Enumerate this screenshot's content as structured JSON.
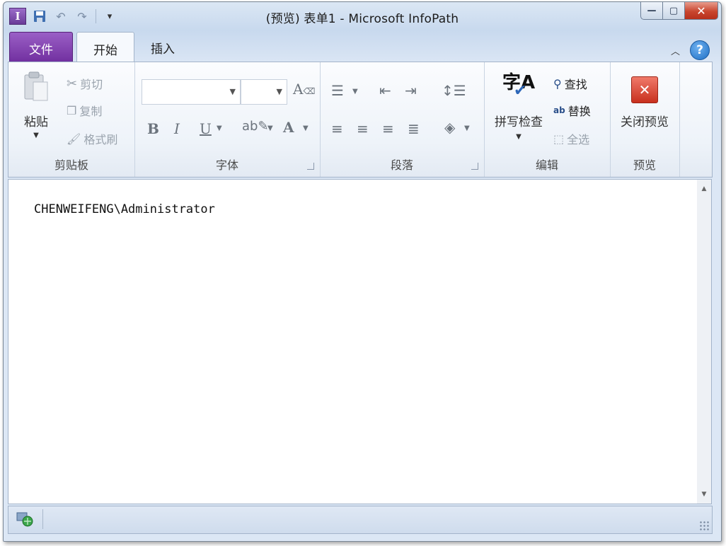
{
  "window": {
    "title": "(预览) 表单1 - Microsoft InfoPath",
    "controls": {
      "minimize": "—",
      "maximize": "▢",
      "close": "✕"
    }
  },
  "qat": {
    "app_icon": "I"
  },
  "tabs": [
    {
      "label": "文件"
    },
    {
      "label": "开始"
    },
    {
      "label": "插入"
    }
  ],
  "ribbon": {
    "clipboard": {
      "label": "剪贴板",
      "paste": "粘贴",
      "cut": "剪切",
      "copy": "复制",
      "format_painter": "格式刷"
    },
    "font": {
      "label": "字体",
      "bold": "B",
      "italic": "I",
      "underline": "U",
      "font_color": "A"
    },
    "paragraph": {
      "label": "段落"
    },
    "editing": {
      "label": "编辑",
      "spell_check": "拼写检查",
      "find": "查找",
      "replace": "替换",
      "select_all": "全选",
      "spell_icon_text": "字A"
    },
    "preview": {
      "label": "预览",
      "close_preview": "关闭预览"
    }
  },
  "document": {
    "text": "CHENWEIFENG\\Administrator"
  }
}
